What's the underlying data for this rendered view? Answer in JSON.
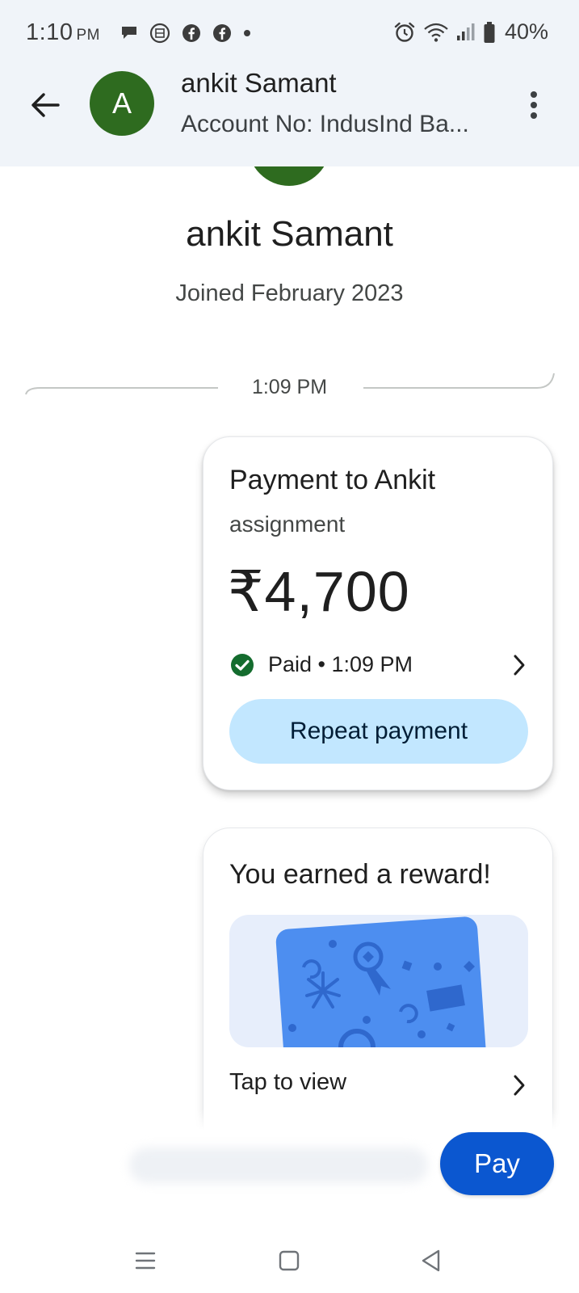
{
  "status_bar": {
    "time": "1:10",
    "ampm": "PM",
    "battery": "40%",
    "icons_left": [
      "chat-bubble-icon",
      "app-notification-icon",
      "facebook-icon",
      "facebook-icon",
      "dot-icon"
    ],
    "icons_right": [
      "alarm-icon",
      "wifi-icon",
      "signal-icon",
      "battery-icon"
    ]
  },
  "header": {
    "avatar_letter": "A",
    "name": "ankit Samant",
    "subtitle": "Account No: IndusInd Ba...",
    "back_icon": "arrow-back-icon",
    "menu_icon": "more-vert-icon"
  },
  "profile": {
    "name": "ankit Samant",
    "joined": "Joined February 2023"
  },
  "divider": {
    "time": "1:09 PM"
  },
  "payment_card": {
    "title": "Payment to Ankit",
    "note": "assignment",
    "amount": "₹4,700",
    "status": "Paid • 1:09 PM",
    "repeat_label": "Repeat payment"
  },
  "reward_card": {
    "title": "You earned a reward!",
    "tap_label": "Tap to view"
  },
  "fab": {
    "label": "Pay"
  },
  "nav": {
    "items": [
      "menu-icon",
      "home-square-icon",
      "back-triangle-icon"
    ]
  },
  "colors": {
    "avatar_green": "#2e6b1f",
    "paid_green": "#146c2e",
    "repeat_button_bg": "#c2e7ff",
    "pay_fab_blue": "#0b57d0",
    "reward_card_blue": "#4d8ef0",
    "header_bg": "#f0f4f9"
  }
}
